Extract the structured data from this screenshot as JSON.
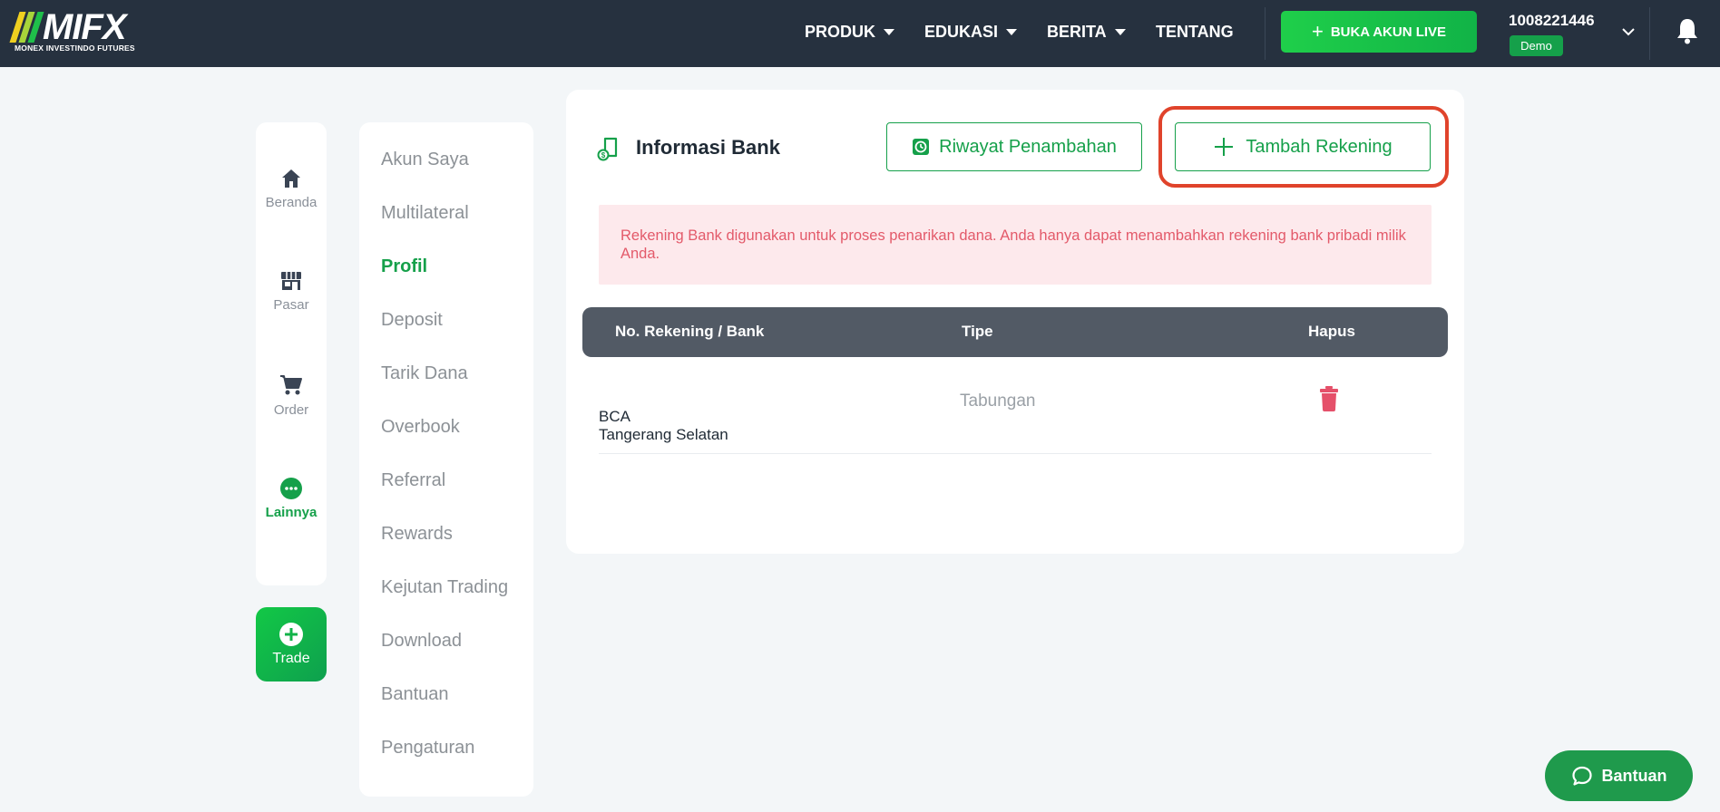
{
  "header": {
    "logo_text": "MIFX",
    "logo_subtitle": "MONEX INVESTINDO FUTURES",
    "nav": [
      {
        "label": "PRODUK",
        "has_dropdown": true
      },
      {
        "label": "EDUKASI",
        "has_dropdown": true
      },
      {
        "label": "BERITA",
        "has_dropdown": true
      },
      {
        "label": "TENTANG",
        "has_dropdown": false
      }
    ],
    "live_button": "BUKA AKUN LIVE",
    "account_number": "1008221446",
    "account_type": "Demo",
    "accent_color": "#15a04a",
    "logo_stripe_colors": [
      "#f0d020",
      "#a8d43a",
      "#1fbf4a"
    ]
  },
  "rail": {
    "items": [
      {
        "label": "Beranda",
        "icon": "home-icon",
        "active": false
      },
      {
        "label": "Pasar",
        "icon": "store-icon",
        "active": false
      },
      {
        "label": "Order",
        "icon": "cart-icon",
        "active": false
      },
      {
        "label": "Lainnya",
        "icon": "more-icon",
        "active": true
      }
    ],
    "trade_label": "Trade"
  },
  "menu": {
    "items": [
      {
        "label": "Akun Saya",
        "active": false
      },
      {
        "label": "Multilateral",
        "active": false
      },
      {
        "label": "Profil",
        "active": true
      },
      {
        "label": "Deposit",
        "active": false
      },
      {
        "label": "Tarik Dana",
        "active": false
      },
      {
        "label": "Overbook",
        "active": false
      },
      {
        "label": "Referral",
        "active": false
      },
      {
        "label": "Rewards",
        "active": false
      },
      {
        "label": "Kejutan Trading",
        "active": false
      },
      {
        "label": "Download",
        "active": false
      },
      {
        "label": "Bantuan",
        "active": false
      },
      {
        "label": "Pengaturan",
        "active": false
      }
    ]
  },
  "bank_info": {
    "title": "Informasi Bank",
    "history_button": "Riwayat Penambahan",
    "add_button": "Tambah Rekening",
    "alert_text": "Rekening Bank digunakan untuk proses penarikan dana. Anda hanya dapat menambahkan rekening bank pribadi milik Anda.",
    "table": {
      "columns": [
        "No. Rekening / Bank",
        "Tipe",
        "Hapus"
      ],
      "rows": [
        {
          "bank": "BCA",
          "branch": "Tangerang Selatan",
          "type": "Tabungan"
        }
      ]
    }
  },
  "help_button": "Bantuan"
}
